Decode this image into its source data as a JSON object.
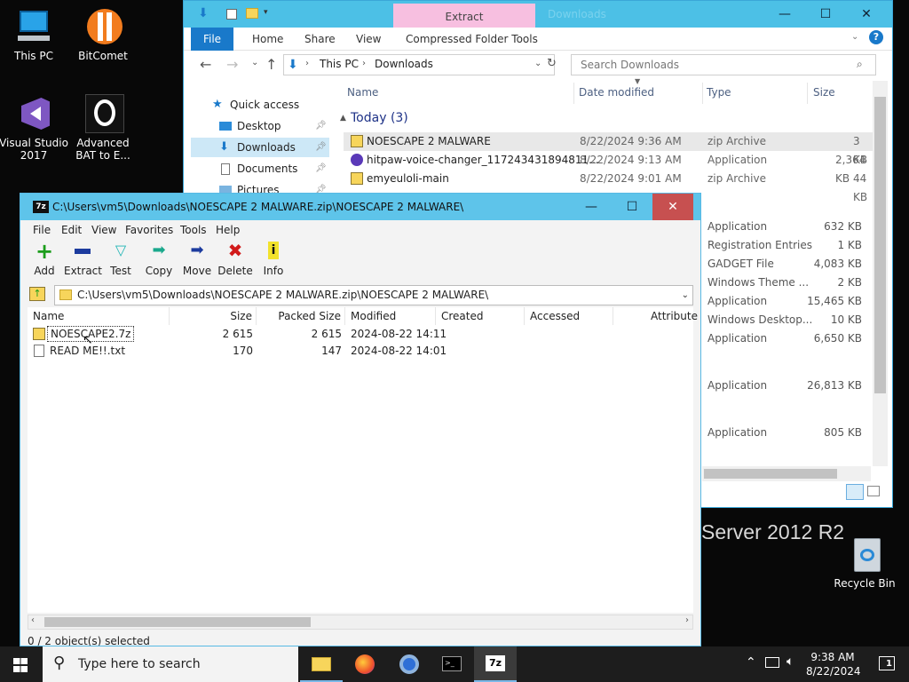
{
  "desktop": {
    "icons": [
      {
        "label": "This PC"
      },
      {
        "label": "BitComet"
      },
      {
        "label": "Visual Studio 2017"
      },
      {
        "label": "Advanced BAT to E..."
      },
      {
        "label": "Recycle Bin"
      }
    ],
    "watermark": "Server 2012 R2"
  },
  "explorer": {
    "ribbon_context_tab": "Extract",
    "window_title": "Downloads",
    "tabs": [
      "File",
      "Home",
      "Share",
      "View",
      "Compressed Folder Tools"
    ],
    "address": {
      "crumb1": "This PC",
      "crumb2": "Downloads"
    },
    "search_placeholder": "Search Downloads",
    "nav": [
      {
        "label": "Quick access"
      },
      {
        "label": "Desktop"
      },
      {
        "label": "Downloads"
      },
      {
        "label": "Documents"
      },
      {
        "label": "Pictures"
      }
    ],
    "columns": {
      "name": "Name",
      "date": "Date modified",
      "type": "Type",
      "size": "Size"
    },
    "group": "Today (3)",
    "files": [
      {
        "name": "NOESCAPE 2 MALWARE",
        "date": "8/22/2024 9:36 AM",
        "type": "zip Archive",
        "size": "3 KB"
      },
      {
        "name": "hitpaw-voice-changer_117243431894811...",
        "date": "8/22/2024 9:13 AM",
        "type": "Application",
        "size": "2,364 KB"
      },
      {
        "name": "emyeuloli-main",
        "date": "8/22/2024 9:01 AM",
        "type": "zip Archive",
        "size": "44 KB"
      }
    ],
    "more_rows": [
      {
        "type": "Application",
        "size": "632 KB"
      },
      {
        "type": "Registration Entries",
        "size": "1 KB"
      },
      {
        "type": "GADGET File",
        "size": "4,083 KB"
      },
      {
        "type": "Windows Theme ...",
        "size": "2 KB"
      },
      {
        "type": "Application",
        "size": "15,465 KB"
      },
      {
        "type": "Windows Desktop...",
        "size": "10 KB"
      },
      {
        "type": "Application",
        "size": "6,650 KB"
      },
      {
        "type": "Application",
        "size": "26,813 KB"
      },
      {
        "type": "Application",
        "size": "805 KB"
      }
    ]
  },
  "sevenzip": {
    "title": "C:\\Users\\vm5\\Downloads\\NOESCAPE 2 MALWARE.zip\\NOESCAPE 2 MALWARE\\",
    "menu": [
      "File",
      "Edit",
      "View",
      "Favorites",
      "Tools",
      "Help"
    ],
    "toolbar": [
      {
        "label": "Add",
        "icon": "add-icon"
      },
      {
        "label": "Extract",
        "icon": "extract-icon"
      },
      {
        "label": "Test",
        "icon": "test-icon"
      },
      {
        "label": "Copy",
        "icon": "copy-icon"
      },
      {
        "label": "Move",
        "icon": "move-icon"
      },
      {
        "label": "Delete",
        "icon": "delete-icon"
      },
      {
        "label": "Info",
        "icon": "info-icon"
      }
    ],
    "path": "C:\\Users\\vm5\\Downloads\\NOESCAPE 2 MALWARE.zip\\NOESCAPE 2 MALWARE\\",
    "columns": [
      "Name",
      "Size",
      "Packed Size",
      "Modified",
      "Created",
      "Accessed",
      "Attribute"
    ],
    "files": [
      {
        "name": "NOESCAPE2.7z",
        "size": "2 615",
        "packed": "2 615",
        "modified": "2024-08-22 14:11"
      },
      {
        "name": "READ ME!!.txt",
        "size": "170",
        "packed": "147",
        "modified": "2024-08-22 14:01"
      }
    ],
    "status": "0 / 2 object(s) selected"
  },
  "taskbar": {
    "search_placeholder": "Type here to search",
    "time": "9:38 AM",
    "date": "8/22/2024",
    "notification_count": "1"
  }
}
